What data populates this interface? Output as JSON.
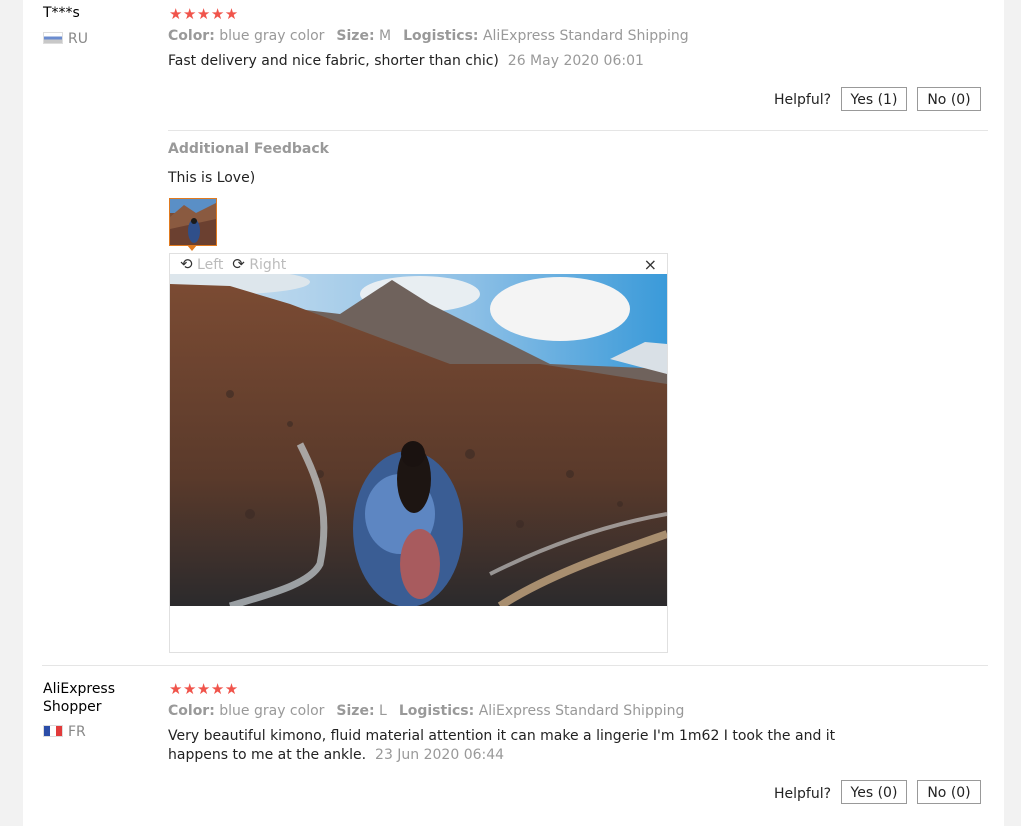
{
  "reviews": [
    {
      "name": "T***s",
      "country": "RU",
      "stars": "★★★★★",
      "color_label": "Color:",
      "color_value": "blue gray color",
      "size_label": "Size:",
      "size_value": "M",
      "logistics_label": "Logistics:",
      "logistics_value": "AliExpress Standard Shipping",
      "text": "Fast delivery and nice fabric, shorter than chic)",
      "date": "26 May 2020 06:01",
      "helpful_label": "Helpful?",
      "yes_label": "Yes (1)",
      "no_label": "No (0)",
      "additional": {
        "heading": "Additional Feedback",
        "text": "This is Love)",
        "viewer": {
          "rotate_left": "Left",
          "rotate_right": "Right",
          "close": "×"
        }
      }
    },
    {
      "name_line1": "AliExpress",
      "name_line2": "Shopper",
      "country": "FR",
      "stars": "★★★★★",
      "color_label": "Color:",
      "color_value": "blue gray color",
      "size_label": "Size:",
      "size_value": "L",
      "logistics_label": "Logistics:",
      "logistics_value": "AliExpress Standard Shipping",
      "text_line1": "Very beautiful kimono, fluid material attention it can make a lingerie I'm 1m62 I took the and it",
      "text_line2": "happens to me at the ankle.",
      "date": "23 Jun 2020 06:44",
      "helpful_label": "Helpful?",
      "yes_label": "Yes (0)",
      "no_label": "No (0)"
    }
  ],
  "icons": {
    "rotate_left": "rotate-left-icon",
    "rotate_right": "rotate-right-icon",
    "close": "close-icon",
    "flag_ru": "flag-ru-icon",
    "flag_fr": "flag-fr-icon"
  },
  "colors": {
    "star": "#f0544b",
    "thumb_border": "#e07a1f"
  }
}
